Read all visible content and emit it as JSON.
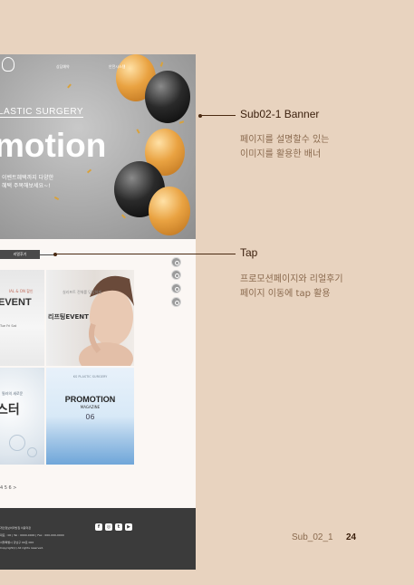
{
  "mock": {
    "nav": {
      "item1": "상담예약",
      "item2": "안전시스템"
    },
    "banner": {
      "surgery_text": "LASTIC SURGERY",
      "title": "motion",
      "subtitle": "이벤트혜택까지 다양한 혜택 주목해보세요~!"
    },
    "tab": {
      "label": "리얼후기"
    },
    "cards": {
      "c1_small": "IAL & ON 할인",
      "c1_event": "EVENT",
      "c1_days": "Tue  Fri  Sat",
      "c2_text": "실리프트 전체를 당당하게",
      "c2_event": "리프팅EVENT",
      "c3_small": "필러의 새로운",
      "c3_title": "스터",
      "c4_top": "KS PLASTIC SURGERY",
      "c4_title": "PROMOTION",
      "c4_mag": "MAGAZINE",
      "c4_num": "06"
    },
    "pager": "4  5  6  >",
    "footer": {
      "line1": "개인정보처리방침   이용약관",
      "line2": "대표 : 00   |   Tel : 0000-0000   |   Fax : 000-000-0000",
      "line3": "서울특별시 강남구 00로 000",
      "line4": "Copyright(c) All rights reserved."
    },
    "social": {
      "facebook": "f",
      "instagram": "◎",
      "twitter": "t",
      "youtube": "▶"
    }
  },
  "annotations": [
    {
      "title": "Sub02-1 Banner",
      "desc1": "페이지를 설명할수 있는",
      "desc2": "이미지를 활용한 배너"
    },
    {
      "title": "Tap",
      "desc1": "프로모션페이지와 리얼후기",
      "desc2": "페이지 이동에 tap 활용"
    }
  ],
  "page_label": {
    "name": "Sub_02_1",
    "number": "24"
  },
  "colors": {
    "background": "#e8d3bf",
    "accent": "#4a2a12",
    "footer": "#3b3b3b"
  }
}
